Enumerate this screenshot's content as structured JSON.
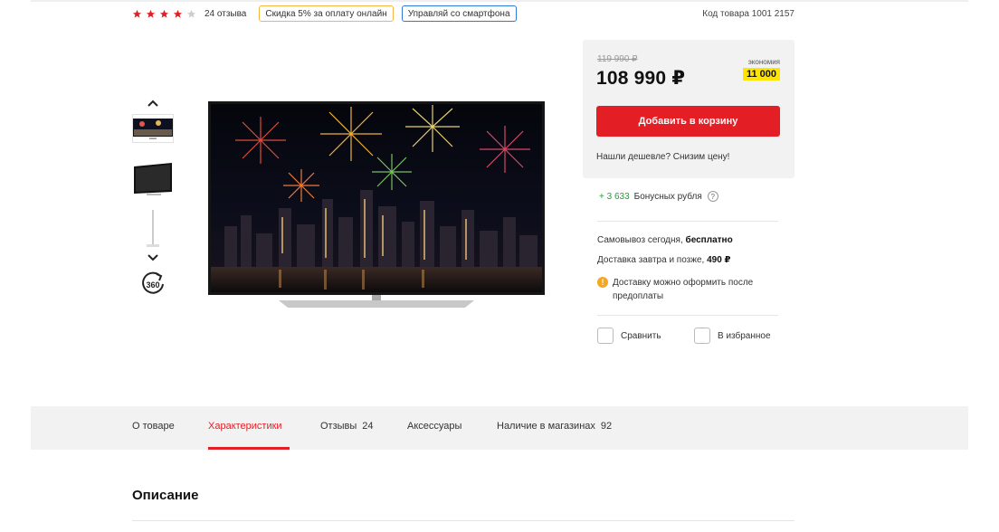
{
  "header": {
    "rating": 4,
    "rating_max": 5,
    "reviews_label": "24 отзыва",
    "badges": [
      "Скидка 5% за оплату онлайн",
      "Управляй со смартфона"
    ],
    "sku_label": "Код товара 1001 2157"
  },
  "gallery": {
    "up_icon": "chevron-up-icon",
    "down_icon": "chevron-down-icon",
    "rotate_label": "360",
    "thumbnails": 3
  },
  "price_box": {
    "old_price": "119 990 ₽",
    "price": "108 990 ₽",
    "saving_label": "экономия",
    "saving_value": "11 000",
    "cart_button": "Добавить в корзину",
    "cheaper_link": "Нашли дешевле? Снизим цену!"
  },
  "bonus": {
    "amount": "+ 3 633",
    "label": "Бонусных рубля",
    "help": "?"
  },
  "delivery": {
    "pickup_prefix": "Самовывоз сегодня, ",
    "pickup_value": "бесплатно",
    "courier_prefix": "Доставка завтра и позже, ",
    "courier_value": "490 ₽",
    "notice": "Доставку можно оформить после предоплаты",
    "notice_icon": "!"
  },
  "actions": {
    "compare": "Сравнить",
    "favorite": "В избранное"
  },
  "tabs": [
    {
      "label": "О товаре",
      "count": ""
    },
    {
      "label": "Характеристики",
      "count": ""
    },
    {
      "label": "Отзывы",
      "count": "24"
    },
    {
      "label": "Аксессуары",
      "count": ""
    },
    {
      "label": "Наличие в магазинах",
      "count": "92"
    }
  ],
  "active_tab": 1,
  "section_title": "Описание",
  "colors": {
    "accent": "#e31e24",
    "star": "#e31e24",
    "saving_bg": "#ffe400",
    "bonus": "#2a9c3c"
  }
}
